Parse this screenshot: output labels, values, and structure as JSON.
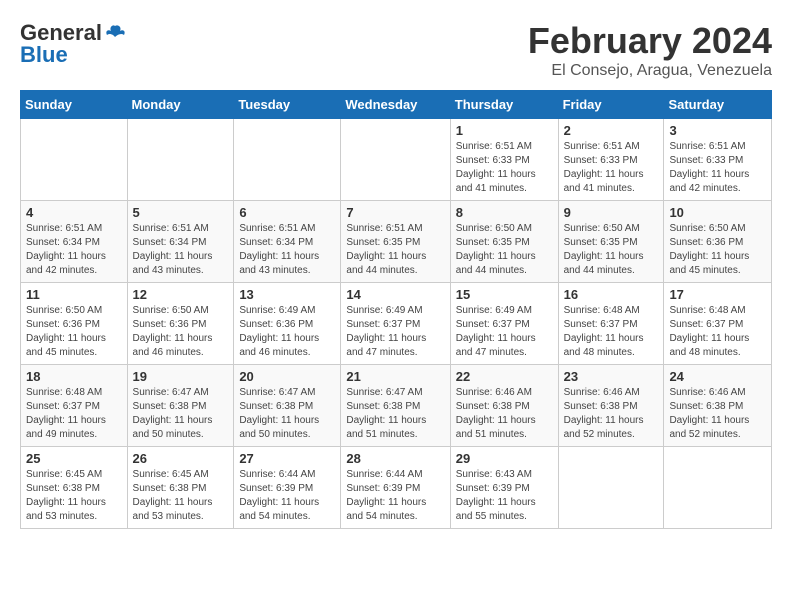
{
  "header": {
    "logo_general": "General",
    "logo_blue": "Blue",
    "month": "February 2024",
    "location": "El Consejo, Aragua, Venezuela"
  },
  "days_of_week": [
    "Sunday",
    "Monday",
    "Tuesday",
    "Wednesday",
    "Thursday",
    "Friday",
    "Saturday"
  ],
  "weeks": [
    [
      {
        "num": "",
        "info": ""
      },
      {
        "num": "",
        "info": ""
      },
      {
        "num": "",
        "info": ""
      },
      {
        "num": "",
        "info": ""
      },
      {
        "num": "1",
        "info": "Sunrise: 6:51 AM\nSunset: 6:33 PM\nDaylight: 11 hours\nand 41 minutes."
      },
      {
        "num": "2",
        "info": "Sunrise: 6:51 AM\nSunset: 6:33 PM\nDaylight: 11 hours\nand 41 minutes."
      },
      {
        "num": "3",
        "info": "Sunrise: 6:51 AM\nSunset: 6:33 PM\nDaylight: 11 hours\nand 42 minutes."
      }
    ],
    [
      {
        "num": "4",
        "info": "Sunrise: 6:51 AM\nSunset: 6:34 PM\nDaylight: 11 hours\nand 42 minutes."
      },
      {
        "num": "5",
        "info": "Sunrise: 6:51 AM\nSunset: 6:34 PM\nDaylight: 11 hours\nand 43 minutes."
      },
      {
        "num": "6",
        "info": "Sunrise: 6:51 AM\nSunset: 6:34 PM\nDaylight: 11 hours\nand 43 minutes."
      },
      {
        "num": "7",
        "info": "Sunrise: 6:51 AM\nSunset: 6:35 PM\nDaylight: 11 hours\nand 44 minutes."
      },
      {
        "num": "8",
        "info": "Sunrise: 6:50 AM\nSunset: 6:35 PM\nDaylight: 11 hours\nand 44 minutes."
      },
      {
        "num": "9",
        "info": "Sunrise: 6:50 AM\nSunset: 6:35 PM\nDaylight: 11 hours\nand 44 minutes."
      },
      {
        "num": "10",
        "info": "Sunrise: 6:50 AM\nSunset: 6:36 PM\nDaylight: 11 hours\nand 45 minutes."
      }
    ],
    [
      {
        "num": "11",
        "info": "Sunrise: 6:50 AM\nSunset: 6:36 PM\nDaylight: 11 hours\nand 45 minutes."
      },
      {
        "num": "12",
        "info": "Sunrise: 6:50 AM\nSunset: 6:36 PM\nDaylight: 11 hours\nand 46 minutes."
      },
      {
        "num": "13",
        "info": "Sunrise: 6:49 AM\nSunset: 6:36 PM\nDaylight: 11 hours\nand 46 minutes."
      },
      {
        "num": "14",
        "info": "Sunrise: 6:49 AM\nSunset: 6:37 PM\nDaylight: 11 hours\nand 47 minutes."
      },
      {
        "num": "15",
        "info": "Sunrise: 6:49 AM\nSunset: 6:37 PM\nDaylight: 11 hours\nand 47 minutes."
      },
      {
        "num": "16",
        "info": "Sunrise: 6:48 AM\nSunset: 6:37 PM\nDaylight: 11 hours\nand 48 minutes."
      },
      {
        "num": "17",
        "info": "Sunrise: 6:48 AM\nSunset: 6:37 PM\nDaylight: 11 hours\nand 48 minutes."
      }
    ],
    [
      {
        "num": "18",
        "info": "Sunrise: 6:48 AM\nSunset: 6:37 PM\nDaylight: 11 hours\nand 49 minutes."
      },
      {
        "num": "19",
        "info": "Sunrise: 6:47 AM\nSunset: 6:38 PM\nDaylight: 11 hours\nand 50 minutes."
      },
      {
        "num": "20",
        "info": "Sunrise: 6:47 AM\nSunset: 6:38 PM\nDaylight: 11 hours\nand 50 minutes."
      },
      {
        "num": "21",
        "info": "Sunrise: 6:47 AM\nSunset: 6:38 PM\nDaylight: 11 hours\nand 51 minutes."
      },
      {
        "num": "22",
        "info": "Sunrise: 6:46 AM\nSunset: 6:38 PM\nDaylight: 11 hours\nand 51 minutes."
      },
      {
        "num": "23",
        "info": "Sunrise: 6:46 AM\nSunset: 6:38 PM\nDaylight: 11 hours\nand 52 minutes."
      },
      {
        "num": "24",
        "info": "Sunrise: 6:46 AM\nSunset: 6:38 PM\nDaylight: 11 hours\nand 52 minutes."
      }
    ],
    [
      {
        "num": "25",
        "info": "Sunrise: 6:45 AM\nSunset: 6:38 PM\nDaylight: 11 hours\nand 53 minutes."
      },
      {
        "num": "26",
        "info": "Sunrise: 6:45 AM\nSunset: 6:38 PM\nDaylight: 11 hours\nand 53 minutes."
      },
      {
        "num": "27",
        "info": "Sunrise: 6:44 AM\nSunset: 6:39 PM\nDaylight: 11 hours\nand 54 minutes."
      },
      {
        "num": "28",
        "info": "Sunrise: 6:44 AM\nSunset: 6:39 PM\nDaylight: 11 hours\nand 54 minutes."
      },
      {
        "num": "29",
        "info": "Sunrise: 6:43 AM\nSunset: 6:39 PM\nDaylight: 11 hours\nand 55 minutes."
      },
      {
        "num": "",
        "info": ""
      },
      {
        "num": "",
        "info": ""
      }
    ]
  ]
}
